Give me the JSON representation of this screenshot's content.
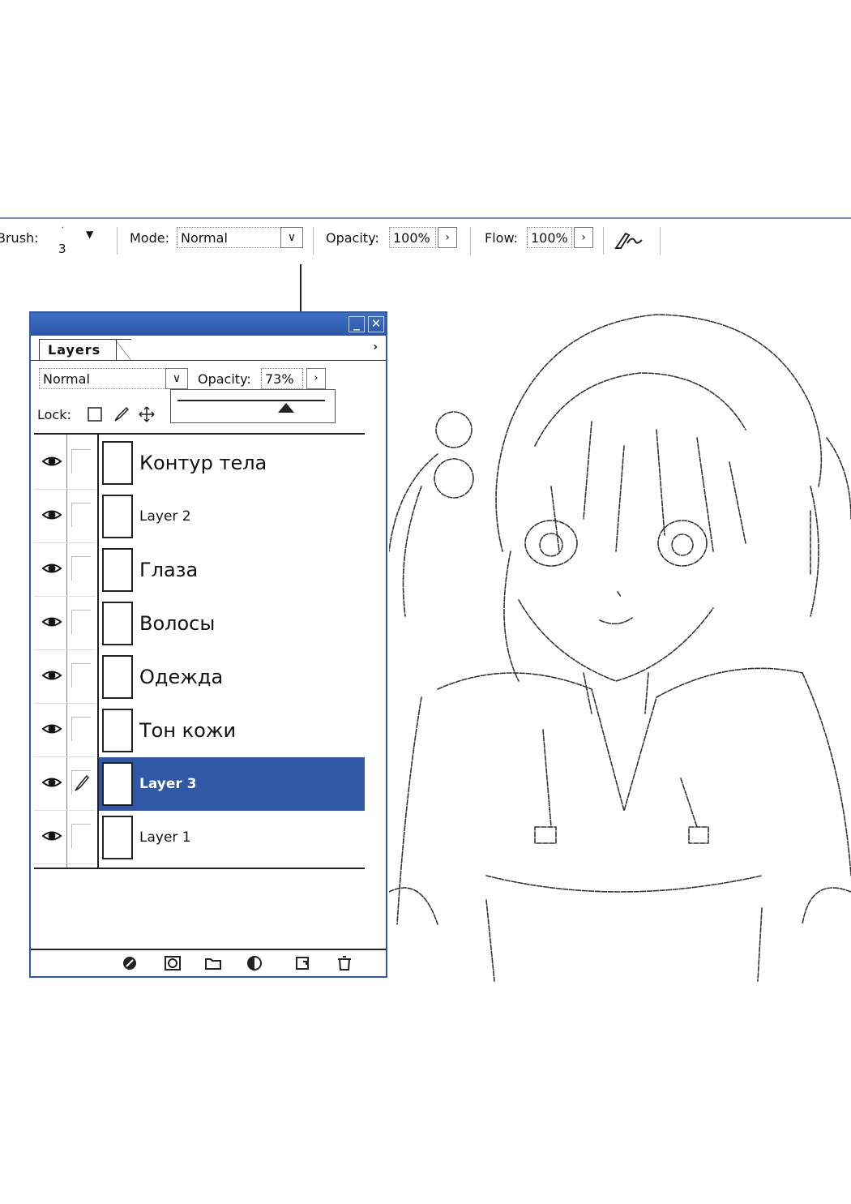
{
  "options_bar": {
    "brush_label": "Brush:",
    "brush_size": "3",
    "mode_label": "Mode:",
    "mode_value": "Normal",
    "opacity_label": "Opacity:",
    "opacity_value": "100%",
    "flow_label": "Flow:",
    "flow_value": "100%",
    "airbrush_icon": "airbrush-icon"
  },
  "palette": {
    "tab_label": "Layers",
    "blend_mode": "Normal",
    "opacity_label": "Opacity:",
    "opacity_value": "73%",
    "opacity_slider_fraction": 0.73,
    "lock_label": "Lock:",
    "layers": [
      {
        "name": "Контур тела",
        "visible": true,
        "selected": false
      },
      {
        "name": "Layer 2",
        "visible": true,
        "selected": false
      },
      {
        "name": "Глаза",
        "visible": true,
        "selected": false
      },
      {
        "name": "Волосы",
        "visible": true,
        "selected": false
      },
      {
        "name": "Одежда",
        "visible": true,
        "selected": false
      },
      {
        "name": "Тон кожи",
        "visible": true,
        "selected": false
      },
      {
        "name": "Layer 3",
        "visible": true,
        "selected": true
      },
      {
        "name": "Layer 1",
        "visible": true,
        "selected": false
      }
    ],
    "bottom_icons": [
      "layer-style-icon",
      "mask-icon",
      "folder-icon",
      "adjustment-layer-icon",
      "new-layer-icon",
      "trash-icon"
    ]
  },
  "colors": {
    "title_bar": "#2a56a8",
    "selection": "#2f58a6"
  }
}
